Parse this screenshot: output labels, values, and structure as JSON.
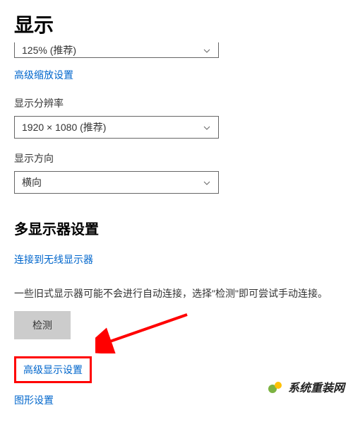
{
  "page": {
    "title": "显示"
  },
  "scaling": {
    "value": "125% (推荐)",
    "advanced_link": "高级缩放设置"
  },
  "resolution": {
    "label": "显示分辨率",
    "value": "1920 × 1080 (推荐)"
  },
  "orientation": {
    "label": "显示方向",
    "value": "横向"
  },
  "multi_display": {
    "title": "多显示器设置",
    "wireless_link": "连接到无线显示器",
    "description": "一些旧式显示器可能不会进行自动连接，选择\"检测\"即可尝试手动连接。",
    "detect_button": "检测",
    "advanced_link": "高级显示设置",
    "graphics_link": "图形设置"
  },
  "watermark": {
    "text": "系统重装网"
  }
}
